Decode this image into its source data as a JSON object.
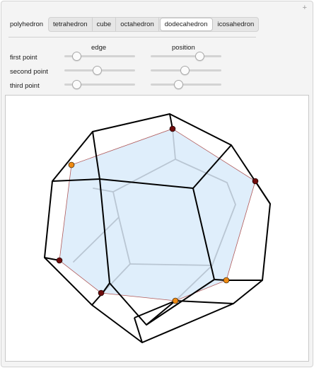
{
  "controls": {
    "add_symbol": "+",
    "polyhedron_label": "polyhedron",
    "polyhedra": [
      "tetrahedron",
      "cube",
      "octahedron",
      "dodecahedron",
      "icosahedron"
    ],
    "selected": "dodecahedron",
    "column_edge": "edge",
    "column_position": "position",
    "rows": [
      {
        "label": "first point",
        "edge": 0.12,
        "position": 0.72
      },
      {
        "label": "second point",
        "edge": 0.45,
        "position": 0.48
      },
      {
        "label": "third point",
        "edge": 0.12,
        "position": 0.38
      }
    ]
  },
  "colors": {
    "edge_line": "#000000",
    "hidden_edge": "#b9c6d3",
    "face_fill": "#dcecfb",
    "section_outline": "#b05a5a",
    "dark_point": "#6e0c0c",
    "orange_point": "#ee8a12"
  }
}
